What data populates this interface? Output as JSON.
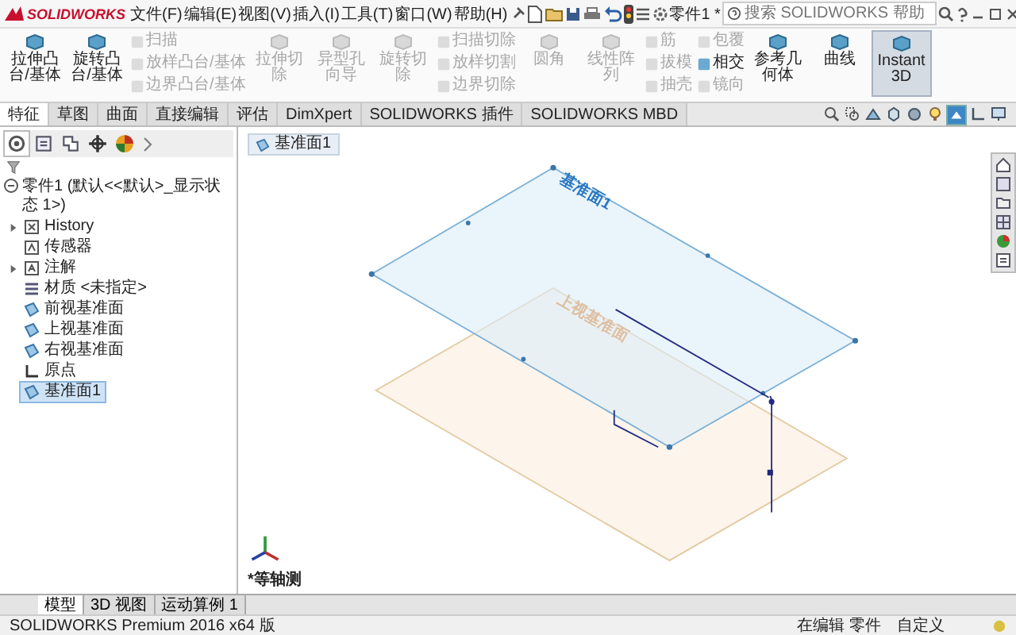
{
  "app": {
    "logo": "SOLIDWORKS",
    "menus": [
      "文件(F)",
      "编辑(E)",
      "视图(V)",
      "插入(I)",
      "工具(T)",
      "窗口(W)",
      "帮助(H)"
    ],
    "title": "零件1 *",
    "search": {
      "placeholder": "搜索 SOLIDWORKS 帮助"
    }
  },
  "ribbon": [
    {
      "kind": "large",
      "label": "拉伸凸台/基体",
      "disabled": false,
      "selected": false
    },
    {
      "kind": "large",
      "label": "旋转凸台/基体",
      "disabled": false,
      "selected": false
    },
    {
      "kind": "small",
      "label": "扫描",
      "disabled": true,
      "selected": false
    },
    {
      "kind": "small",
      "label": "放样凸台/基体",
      "disabled": true,
      "selected": false
    },
    {
      "kind": "small",
      "label": "边界凸台/基体",
      "disabled": true,
      "selected": false
    },
    {
      "kind": "large",
      "label": "拉伸切除",
      "disabled": true,
      "selected": false
    },
    {
      "kind": "large",
      "label": "异型孔向导",
      "disabled": true,
      "selected": false
    },
    {
      "kind": "large",
      "label": "旋转切除",
      "disabled": true,
      "selected": false
    },
    {
      "kind": "small",
      "label": "扫描切除",
      "disabled": true,
      "selected": false
    },
    {
      "kind": "small",
      "label": "放样切割",
      "disabled": true,
      "selected": false
    },
    {
      "kind": "small",
      "label": "边界切除",
      "disabled": true,
      "selected": false
    },
    {
      "kind": "large",
      "label": "圆角",
      "disabled": true,
      "selected": false
    },
    {
      "kind": "large",
      "label": "线性阵列",
      "disabled": true,
      "selected": false
    },
    {
      "kind": "small",
      "label": "筋",
      "disabled": true,
      "selected": false
    },
    {
      "kind": "small",
      "label": "拔模",
      "disabled": true,
      "selected": false
    },
    {
      "kind": "small",
      "label": "抽壳",
      "disabled": true,
      "selected": false
    },
    {
      "kind": "small",
      "label": "包覆",
      "disabled": true,
      "selected": false
    },
    {
      "kind": "small",
      "label": "相交",
      "disabled": false,
      "selected": false
    },
    {
      "kind": "small",
      "label": "镜向",
      "disabled": true,
      "selected": false
    },
    {
      "kind": "large",
      "label": "参考几何体",
      "disabled": false,
      "selected": false
    },
    {
      "kind": "large",
      "label": "曲线",
      "disabled": false,
      "selected": false
    },
    {
      "kind": "large",
      "label": "Instant3D",
      "disabled": false,
      "selected": true
    }
  ],
  "command_tabs": [
    {
      "label": "特征",
      "selected": true
    },
    {
      "label": "草图",
      "selected": false
    },
    {
      "label": "曲面",
      "selected": false
    },
    {
      "label": "直接编辑",
      "selected": false
    },
    {
      "label": "评估",
      "selected": false
    },
    {
      "label": "DimXpert",
      "selected": false
    },
    {
      "label": "SOLIDWORKS 插件",
      "selected": false
    },
    {
      "label": "SOLIDWORKS MBD",
      "selected": false
    }
  ],
  "feature_tree": {
    "root": "零件1 (默认<<默认>_显示状态 1>)",
    "items": [
      {
        "kind": "history",
        "label": "History",
        "expandable": true,
        "selected": false
      },
      {
        "kind": "sensor",
        "label": "传感器",
        "expandable": false,
        "selected": false
      },
      {
        "kind": "annotation",
        "label": "注解",
        "expandable": true,
        "selected": false
      },
      {
        "kind": "material",
        "label": "材质 <未指定>",
        "expandable": false,
        "selected": false
      },
      {
        "kind": "plane",
        "label": "前视基准面",
        "expandable": false,
        "selected": false
      },
      {
        "kind": "plane",
        "label": "上视基准面",
        "expandable": false,
        "selected": false
      },
      {
        "kind": "plane",
        "label": "右视基准面",
        "expandable": false,
        "selected": false
      },
      {
        "kind": "origin",
        "label": "原点",
        "expandable": false,
        "selected": false
      },
      {
        "kind": "plane",
        "label": "基准面1",
        "expandable": false,
        "selected": true
      }
    ]
  },
  "viewport": {
    "breadcrumb": "基准面1",
    "planes": [
      {
        "kind": "top",
        "label": "上视基准面"
      },
      {
        "kind": "new",
        "label": "基准面1"
      }
    ],
    "view_name": "*等轴测"
  },
  "bottom_tabs": [
    {
      "label": "模型",
      "selected": true
    },
    {
      "label": "3D 视图",
      "selected": false
    },
    {
      "label": "运动算例 1",
      "selected": false
    }
  ],
  "status_bar": {
    "product": "SOLIDWORKS Premium 2016 x64 版",
    "mode": "在编辑 零件",
    "units": "自定义"
  }
}
